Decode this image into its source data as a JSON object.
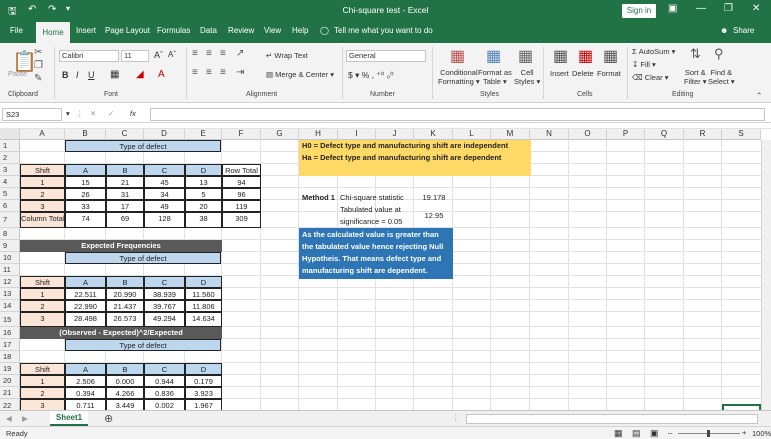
{
  "window": {
    "title": "Chi-square test  -  Excel",
    "signin": "Sign in",
    "share": "Share",
    "tell_me": "Tell me what you want to do"
  },
  "tabs": [
    "File",
    "Home",
    "Insert",
    "Page Layout",
    "Formulas",
    "Data",
    "Review",
    "View",
    "Help"
  ],
  "ribbon": {
    "clipboard": {
      "label": "Clipboard",
      "paste": "Paste"
    },
    "font": {
      "label": "Font",
      "name": "Calibri",
      "size": "11"
    },
    "alignment": {
      "label": "Alignment",
      "wrap": "Wrap Text",
      "merge": "Merge & Center"
    },
    "number": {
      "label": "Number",
      "format": "General"
    },
    "styles": {
      "label": "Styles",
      "conditional": "Conditional\nFormatting",
      "format_table": "Format as\nTable",
      "cell_styles": "Cell\nStyles"
    },
    "cells": {
      "label": "Cells",
      "insert": "Insert",
      "delete": "Delete",
      "format": "Format"
    },
    "editing": {
      "label": "Editing",
      "autosum": "AutoSum",
      "fill": "Fill",
      "clear": "Clear",
      "sort": "Sort &\nFilter",
      "find": "Find &\nSelect"
    }
  },
  "formula_bar": {
    "name_box": "S23",
    "formula": ""
  },
  "columns": [
    "A",
    "B",
    "C",
    "D",
    "E",
    "F",
    "G",
    "H",
    "I",
    "J",
    "K",
    "L",
    "M",
    "N",
    "O",
    "P",
    "Q",
    "R",
    "S"
  ],
  "rows": [
    "1",
    "2",
    "3",
    "4",
    "5",
    "6",
    "7",
    "8",
    "9",
    "10",
    "11",
    "12",
    "13",
    "14",
    "15",
    "16",
    "17",
    "18",
    "19",
    "20",
    "21",
    "22",
    "23"
  ],
  "table1": {
    "title": "Type of defect",
    "header": [
      "Shift",
      "A",
      "B",
      "C",
      "D",
      "Row Total"
    ],
    "rows": [
      [
        "1",
        "15",
        "21",
        "45",
        "13",
        "94"
      ],
      [
        "2",
        "26",
        "31",
        "34",
        "5",
        "96"
      ],
      [
        "3",
        "33",
        "17",
        "49",
        "20",
        "119"
      ]
    ],
    "total": [
      "Column Total",
      "74",
      "69",
      "128",
      "38",
      "309"
    ]
  },
  "hypotheses": {
    "h0": "H0 = Defect type and manufacturing shift are independent",
    "ha": "Ha = Defect type and manufacturing shift are dependent"
  },
  "method": {
    "label": "Method 1",
    "stat_label": "Chi-square statistic",
    "stat_value": "19.178",
    "tab_label_1": "Tabulated value at",
    "tab_label_2": "significance = 0.05",
    "tab_value": "12.95"
  },
  "conclusion": [
    "As the calculated value is greater than",
    "the tabulated value hence rejecting Null",
    "Hypotheis. That means defect type and",
    "manufacturing shift are dependent."
  ],
  "table2": {
    "heading": "Expected Frequencies",
    "title": "Type of defect",
    "header": [
      "Shift",
      "A",
      "B",
      "C",
      "D"
    ],
    "rows": [
      [
        "1",
        "22.511",
        "20.990",
        "38.939",
        "11.560"
      ],
      [
        "2",
        "22.990",
        "21.437",
        "39.767",
        "11.806"
      ],
      [
        "3",
        "28.498",
        "26.573",
        "49.294",
        "14.634"
      ]
    ]
  },
  "table3": {
    "heading": "(Observed - Expected)^2/Expected",
    "title": "Type of defect",
    "header": [
      "Shift",
      "A",
      "B",
      "C",
      "D"
    ],
    "rows": [
      [
        "1",
        "2.506",
        "0.000",
        "0.944",
        "0.179"
      ],
      [
        "2",
        "0.394",
        "4.266",
        "0.836",
        "3.923"
      ],
      [
        "3",
        "0.711",
        "3.449",
        "0.002",
        "1.967"
      ]
    ]
  },
  "sheet_tab": "Sheet1",
  "status": {
    "ready": "Ready",
    "zoom": "100%"
  }
}
